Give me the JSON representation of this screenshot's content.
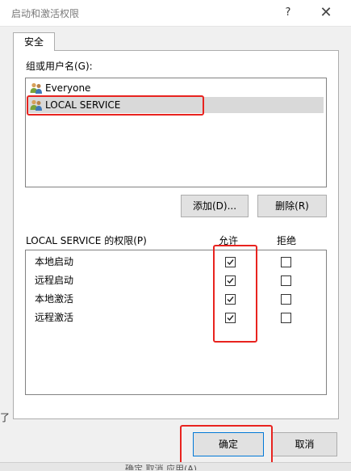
{
  "window": {
    "title": "启动和激活权限",
    "help": "?",
    "close": "✕"
  },
  "tabs": [
    {
      "label": "安全"
    }
  ],
  "group_section": {
    "label": "组或用户名(G):"
  },
  "users": [
    {
      "name": "Everyone",
      "icon": "users-icon"
    },
    {
      "name": "LOCAL SERVICE",
      "icon": "users-icon",
      "selected": true
    }
  ],
  "buttons": {
    "add": "添加(D)...",
    "remove": "删除(R)",
    "ok": "确定",
    "cancel": "取消"
  },
  "permissions": {
    "label": "LOCAL SERVICE 的权限(P)",
    "allow_header": "允许",
    "deny_header": "拒绝",
    "rows": [
      {
        "name": "本地启动",
        "allow": true,
        "deny": false
      },
      {
        "name": "远程启动",
        "allow": true,
        "deny": false
      },
      {
        "name": "本地激活",
        "allow": true,
        "deny": false
      },
      {
        "name": "远程激活",
        "allow": true,
        "deny": false
      }
    ]
  },
  "background": {
    "left_text": "了",
    "bottom_text": "确定      取消      应用(A)"
  },
  "colors": {
    "highlight": "#e8231f",
    "accent": "#0078d7"
  }
}
